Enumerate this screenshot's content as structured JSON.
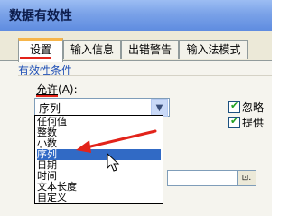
{
  "window": {
    "title": "数据有效性"
  },
  "tabs": [
    {
      "label": "设置"
    },
    {
      "label": "输入信息"
    },
    {
      "label": "出错警告"
    },
    {
      "label": "输入法模式"
    }
  ],
  "group": {
    "label": "有效性条件"
  },
  "allow": {
    "label": "允许",
    "shortcut": "(A):",
    "value": "序列",
    "options": [
      "任何值",
      "整数",
      "小数",
      "序列",
      "日期",
      "时间",
      "文本长度",
      "自定义"
    ],
    "selected_index": 3
  },
  "checkboxes": [
    {
      "label": "忽略",
      "checked": true
    },
    {
      "label": "提供",
      "checked": true
    }
  ],
  "ref_button": {
    "icon": "range-select-icon",
    "glyph": "⊡."
  },
  "colors": {
    "annotation": "#e2231a",
    "selection": "#316ac5",
    "title_bar": "#7aa2e8"
  }
}
